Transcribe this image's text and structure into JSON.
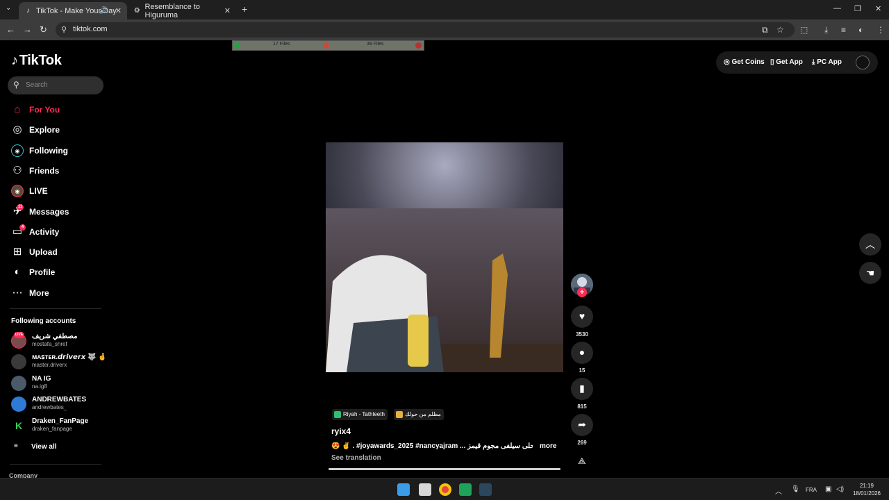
{
  "browser": {
    "tabs": [
      {
        "title": "TikTok - Make Your Day",
        "active": true
      },
      {
        "title": "Resemblance to Higuruma",
        "active": false
      }
    ],
    "url": "tiktok.com"
  },
  "files_bar": {
    "left": "17 Files",
    "right": "38 Files"
  },
  "sidebar": {
    "logo": "TikTok",
    "search_placeholder": "Search",
    "nav": [
      {
        "label": "For You",
        "icon": "home-icon",
        "active": true
      },
      {
        "label": "Explore",
        "icon": "compass-icon"
      },
      {
        "label": "Following",
        "icon": "following-icon"
      },
      {
        "label": "Friends",
        "icon": "friends-icon"
      },
      {
        "label": "LIVE",
        "icon": "live-icon"
      },
      {
        "label": "Messages",
        "icon": "messages-icon",
        "badge": "11"
      },
      {
        "label": "Activity",
        "icon": "activity-icon",
        "badge": "4"
      },
      {
        "label": "Upload",
        "icon": "upload-icon"
      },
      {
        "label": "Profile",
        "icon": "profile-icon"
      },
      {
        "label": "More",
        "icon": "more-icon"
      }
    ],
    "following_title": "Following accounts",
    "accounts": [
      {
        "name": "مصطفي شريف",
        "handle": "mostafa_shref",
        "badge": "LIVE"
      },
      {
        "name": "ᴍᴀꜱᴛᴇʀ.𝙙𝙧𝙞𝙫𝙚𝙧𝙭 🐺 🤞",
        "handle": "master.driverx"
      },
      {
        "name": "NA IG",
        "handle": "na.ig8"
      },
      {
        "name": "ANDREWBATES",
        "handle": "andrewbates_"
      },
      {
        "name": "Draken_FanPage",
        "handle": "draken_fanpage"
      }
    ],
    "view_all": "View all",
    "company": "Company"
  },
  "header": {
    "get_coins": "Get Coins",
    "get_app": "Get App",
    "pc_app": "PC App"
  },
  "video": {
    "progress": 1.0,
    "likes": "3530",
    "comments": "15",
    "saves": "815",
    "shares": "269",
    "chips": [
      "Riyah - Tathleeth",
      "مظلم من حولك"
    ],
    "username": "ryix4",
    "description": "😍 ✌️ . #joyawards_2025 #nancyajram ... أحلى سيلفى مجوم قيمز",
    "more": "more",
    "see_translation": "See translation"
  },
  "taskbar": {
    "lang": "FRA",
    "time": "21:19",
    "date": "18/01/2026"
  },
  "colors": {
    "accent": "#fe2c55"
  }
}
